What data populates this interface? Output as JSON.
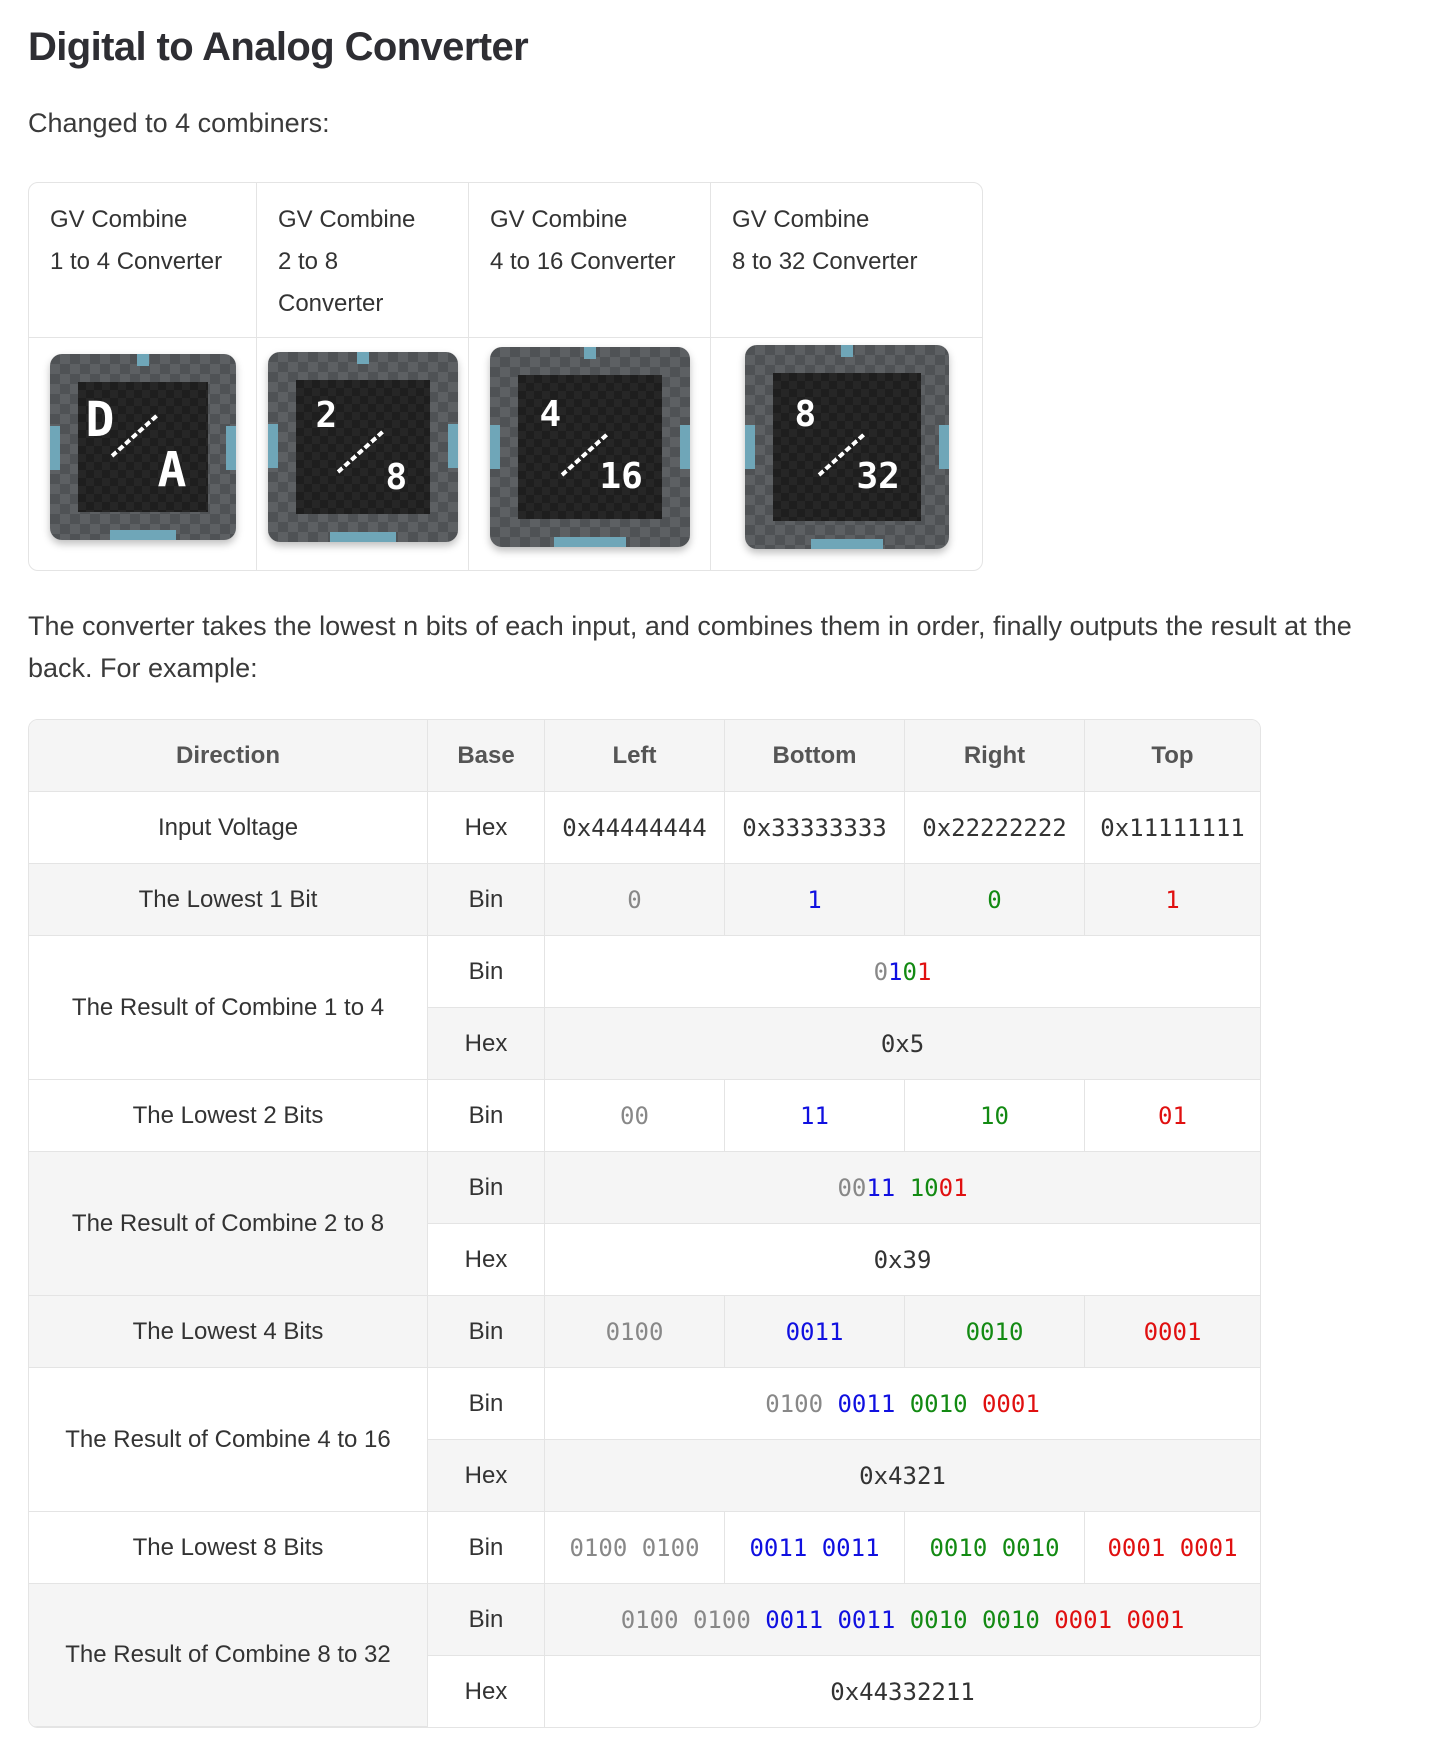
{
  "title": "Digital to Analog Converter",
  "intro": "Changed to 4 combiners:",
  "blocks": [
    {
      "line1": "GV Combine",
      "line2": "1 to 4 Converter",
      "icon_top": "D",
      "icon_bottom": "A"
    },
    {
      "line1": "GV Combine",
      "line2": "2 to 8 Converter",
      "icon_top": "2",
      "icon_bottom": "8"
    },
    {
      "line1": "GV Combine",
      "line2": "4 to 16 Converter",
      "icon_top": "4",
      "icon_bottom": "16"
    },
    {
      "line1": "GV Combine",
      "line2": "8 to 32 Converter",
      "icon_top": "8",
      "icon_bottom": "32"
    }
  ],
  "description": "The converter takes the lowest n bits of each input, and combines them in order, finally outputs the result at the back. For example:",
  "table": {
    "headers": [
      "Direction",
      "Base",
      "Left",
      "Bottom",
      "Right",
      "Top"
    ],
    "input": {
      "label": "Input Voltage",
      "base": "Hex",
      "values": [
        "0x44444444",
        "0x33333333",
        "0x22222222",
        "0x11111111"
      ]
    },
    "low1": {
      "label": "The Lowest 1 Bit",
      "base": "Bin",
      "values": [
        "0",
        "1",
        "0",
        "1"
      ]
    },
    "res1": {
      "label": "The Result of Combine 1 to 4",
      "bin_base": "Bin",
      "hex_base": "Hex",
      "bin": [
        "0",
        "1",
        "0",
        "1"
      ],
      "hex": "0x5"
    },
    "low2": {
      "label": "The Lowest 2 Bits",
      "base": "Bin",
      "values": [
        "00",
        "11",
        "10",
        "01"
      ]
    },
    "res2": {
      "label": "The Result of Combine 2 to 8",
      "bin_base": "Bin",
      "hex_base": "Hex",
      "bin": [
        "00",
        "11 ",
        "10",
        "01"
      ],
      "hex": "0x39"
    },
    "low4": {
      "label": "The Lowest 4 Bits",
      "base": "Bin",
      "values": [
        "0100",
        "0011",
        "0010",
        "0001"
      ]
    },
    "res4": {
      "label": "The Result of Combine 4 to 16",
      "bin_base": "Bin",
      "hex_base": "Hex",
      "bin": [
        "0100 ",
        "0011 ",
        "0010 ",
        "0001"
      ],
      "hex": "0x4321"
    },
    "low8": {
      "label": "The Lowest 8 Bits",
      "base": "Bin",
      "values": [
        "0100 0100",
        "0011 0011",
        "0010 0010",
        "0001 0001"
      ]
    },
    "res8": {
      "label": "The Result of Combine 8 to 32",
      "bin_base": "Bin",
      "hex_base": "Hex",
      "bin": [
        "0100 0100 ",
        "0011 0011 ",
        "0010 0010 ",
        "0001 0001"
      ],
      "hex": "0x44332211"
    }
  },
  "colors": {
    "left": "#888888",
    "bottom": "#1010e0",
    "right": "#138a13",
    "top": "#e01010"
  }
}
